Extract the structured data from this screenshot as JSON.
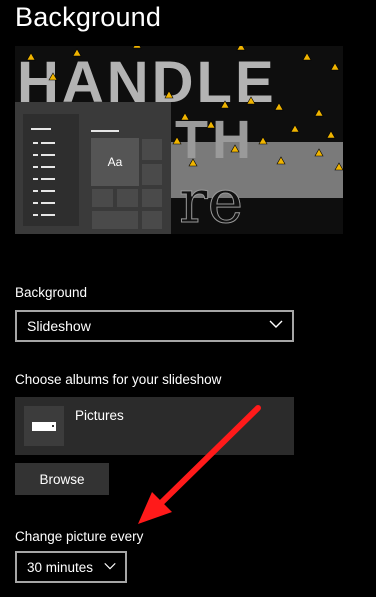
{
  "page": {
    "title": "Background"
  },
  "preview": {
    "wallpaper_text_line1": "HANDLE",
    "wallpaper_text_line2": "TH",
    "wallpaper_text_line3": "re",
    "tile_label": "Aa"
  },
  "background": {
    "label": "Background",
    "selected": "Slideshow"
  },
  "albums": {
    "label": "Choose albums for your slideshow",
    "items": [
      {
        "name": "Pictures",
        "icon": "folder-icon"
      }
    ],
    "browse_label": "Browse"
  },
  "interval": {
    "label": "Change picture every",
    "selected": "30 minutes"
  },
  "annotation": {
    "type": "arrow",
    "color": "#ff1a1a"
  },
  "colors": {
    "background": "#000000",
    "panel": "#2b2b2b",
    "button": "#333333",
    "border": "#a6a6a6",
    "warning": "#f0b400"
  }
}
